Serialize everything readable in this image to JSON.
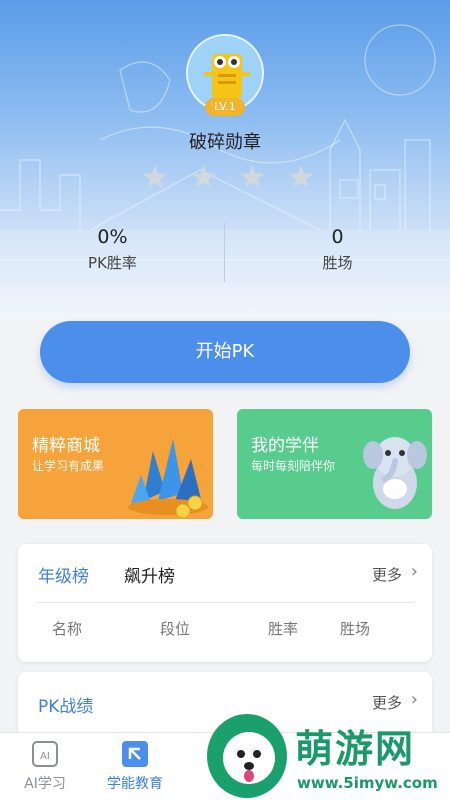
{
  "profile": {
    "level": "LV.1",
    "badge_name": "破碎勋章",
    "stars_total": 4,
    "stars_earned": 0
  },
  "stats": [
    {
      "value": "0%",
      "label": "PK胜率"
    },
    {
      "value": "0",
      "label": "胜场"
    }
  ],
  "start_button": "开始PK",
  "cards": {
    "shop": {
      "title": "精粹商城",
      "subtitle": "让学习有成果"
    },
    "partner": {
      "title": "我的学伴",
      "subtitle": "每时每刻陪伴你"
    }
  },
  "leaderboard": {
    "tabs": [
      "年级榜",
      "飙升榜"
    ],
    "more": "更多",
    "columns": [
      "名称",
      "段位",
      "胜率",
      "胜场"
    ]
  },
  "pk_record": {
    "title": "PK战绩",
    "more": "更多"
  },
  "tabbar": [
    {
      "label": "AI学习",
      "icon": "ai-study-icon"
    },
    {
      "label": "学能教育",
      "icon": "education-icon"
    }
  ],
  "watermark": {
    "brand": "萌游网",
    "url": "www.5imyw.com"
  },
  "colors": {
    "accent": "#4c8fea",
    "shop": "#f6a33b",
    "partner": "#58cc8d",
    "watermark": "#1a9a68"
  }
}
